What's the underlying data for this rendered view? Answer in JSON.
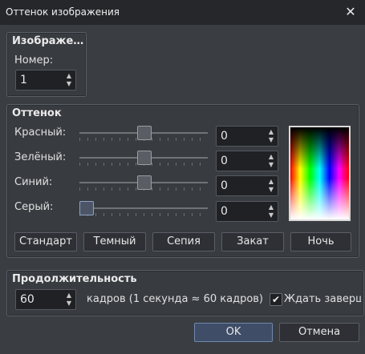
{
  "window": {
    "title": "Оттенок изображения",
    "close_glyph": "✕"
  },
  "image_group": {
    "title": "Изображе…",
    "number_label": "Номер:",
    "number_value": "1"
  },
  "tint_group": {
    "title": "Оттенок",
    "red_label": "Красный:",
    "red_value": "0",
    "green_label": "Зелёный:",
    "green_value": "0",
    "blue_label": "Синий:",
    "blue_value": "0",
    "gray_label": "Серый:",
    "gray_value": "0",
    "presets": [
      "Стандарт",
      "Темный",
      "Сепия",
      "Закат",
      "Ночь"
    ]
  },
  "duration_group": {
    "title": "Продолжительность",
    "frames_value": "60",
    "frames_text": "кадров (1 секунда ≈ 60 кадров)",
    "wait_label": "Ждать заверше",
    "wait_checked": true
  },
  "footer": {
    "ok_label": "OK",
    "cancel_label": "Отмена"
  },
  "icons": {
    "spin_up": "▲",
    "spin_down": "▼",
    "check": "✔"
  }
}
